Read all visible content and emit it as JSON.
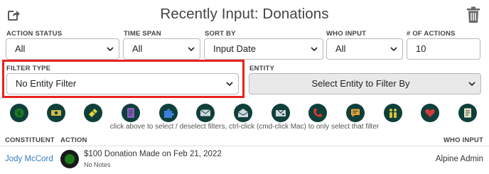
{
  "header": {
    "title": "Recently Input: Donations",
    "export_icon": "export-arrow-icon",
    "trash_icon": "trash-icon"
  },
  "filters": {
    "action_status": {
      "label": "ACTION STATUS",
      "value": "All"
    },
    "time_span": {
      "label": "TIME SPAN",
      "value": "All"
    },
    "sort_by": {
      "label": "SORT BY",
      "value": "Input Date"
    },
    "who_input": {
      "label": "WHO INPUT",
      "value": "All"
    },
    "num_actions": {
      "label": "# OF ACTIONS",
      "value": "10"
    },
    "filter_type": {
      "label": "FILTER TYPE",
      "value": "No Entity Filter"
    },
    "entity": {
      "label": "ENTITY",
      "value": "Select Entity to Filter By"
    }
  },
  "action_icons": [
    {
      "name": "donation-icon",
      "color": "#1f7a1f"
    },
    {
      "name": "cash-icon",
      "color": "#d4b84a"
    },
    {
      "name": "ticket-icon",
      "color": "#e3d83a"
    },
    {
      "name": "document-purple-icon",
      "color": "#8a5bbd"
    },
    {
      "name": "puzzle-icon",
      "color": "#3d7fd6"
    },
    {
      "name": "envelope-icon",
      "color": "#cfd6dc"
    },
    {
      "name": "open-envelope-icon",
      "color": "#cfd6dc"
    },
    {
      "name": "mail-tray-icon",
      "color": "#cfd6dc"
    },
    {
      "name": "phone-icon",
      "color": "#d9392b"
    },
    {
      "name": "chat-icon",
      "color": "#e8a03a"
    },
    {
      "name": "people-icon",
      "color": "#d6c33a"
    },
    {
      "name": "heart-book-icon",
      "color": "#cf3b3b"
    },
    {
      "name": "note-icon",
      "color": "#e8e2c6"
    }
  ],
  "hint_text": "click above to select / deselect filters, ctrl-click (cmd-click Mac) to only select that filter",
  "table": {
    "col_constituent": "CONSTITUENT",
    "col_action": "ACTION",
    "col_who_input": "WHO INPUT",
    "rows": [
      {
        "constituent": "Jody McCord",
        "icon": "donation-icon",
        "title": "$100 Donation Made on Feb 21, 2022",
        "subtitle": "No Notes",
        "who_input": "Alpine Admin"
      }
    ]
  }
}
